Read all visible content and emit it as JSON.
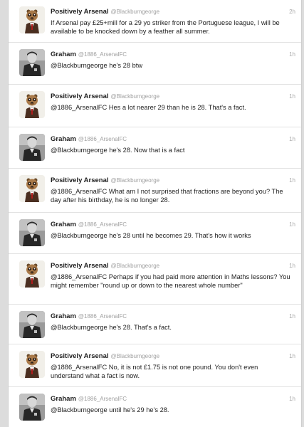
{
  "tweets": [
    {
      "avatar": "meerkat-avatar",
      "name": "Positively Arsenal",
      "handle": "@Blackburngeorge",
      "time": "2h",
      "text": "If Arsenal pay £25+mill for a 29 yo striker from the  Portuguese league, I will be available to be knocked down by a feather all summer."
    },
    {
      "avatar": "graham-avatar",
      "name": "Graham",
      "handle": "@1886_ArsenalFC",
      "time": "1h",
      "text": "@Blackburngeorge he's 28 btw"
    },
    {
      "avatar": "meerkat-avatar",
      "name": "Positively Arsenal",
      "handle": "@Blackburngeorge",
      "time": "1h",
      "text": "@1886_ArsenalFC Hes a lot nearer 29 than he is 28. That's a fact."
    },
    {
      "avatar": "graham-avatar",
      "name": "Graham",
      "handle": "@1886_ArsenalFC",
      "time": "1h",
      "text": "@Blackburngeorge he's 28. Now that is a fact"
    },
    {
      "avatar": "meerkat-avatar",
      "name": "Positively Arsenal",
      "handle": "@Blackburngeorge",
      "time": "1h",
      "text": "@1886_ArsenalFC  What am I not surprised that fractions are beyond you? The day after his birthday, he is no longer 28."
    },
    {
      "avatar": "graham-avatar",
      "name": "Graham",
      "handle": "@1886_ArsenalFC",
      "time": "1h",
      "text": "@Blackburngeorge he's 28 until he becomes 29. That's how it works"
    },
    {
      "avatar": "meerkat-avatar",
      "name": "Positively Arsenal",
      "handle": "@Blackburngeorge",
      "time": "1h",
      "text": "@1886_ArsenalFC Perhaps if you had paid more attention in Maths lessons? You might remember \"round up or down to the nearest whole number\""
    },
    {
      "avatar": "graham-avatar",
      "name": "Graham",
      "handle": "@1886_ArsenalFC",
      "time": "1h",
      "text": "@Blackburngeorge he's 28. That's a fact."
    },
    {
      "avatar": "meerkat-avatar",
      "name": "Positively Arsenal",
      "handle": "@Blackburngeorge",
      "time": "1h",
      "text": "@1886_ArsenalFC No, it is not £1.75 is not one pound. You don't even understand what a fact is now."
    },
    {
      "avatar": "graham-avatar",
      "name": "Graham",
      "handle": "@1886_ArsenalFC",
      "time": "1h",
      "text": "@Blackburngeorge until he's 29 he's 28."
    }
  ]
}
